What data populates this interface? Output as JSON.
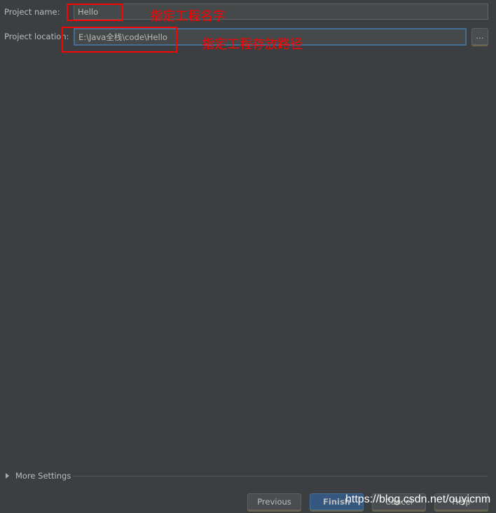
{
  "form": {
    "project_name_label": "Project name:",
    "project_name_value": "Hello",
    "project_location_label": "Project location:",
    "project_location_value": "E:\\Java全栈\\code\\Hello",
    "browse_label": "..."
  },
  "annotations": {
    "name_note": "指定工程名字",
    "location_note": "指定工程存放路径"
  },
  "more_settings": {
    "label": "More Settings"
  },
  "buttons": {
    "previous": "Previous",
    "finish": "Finish",
    "cancel": "Cancel",
    "help": "Help"
  },
  "watermark": "https://blog.csdn.net/ouyicnm",
  "colors": {
    "background": "#3c3f41",
    "primary_button": "#365880",
    "annotation": "#ff0000"
  }
}
